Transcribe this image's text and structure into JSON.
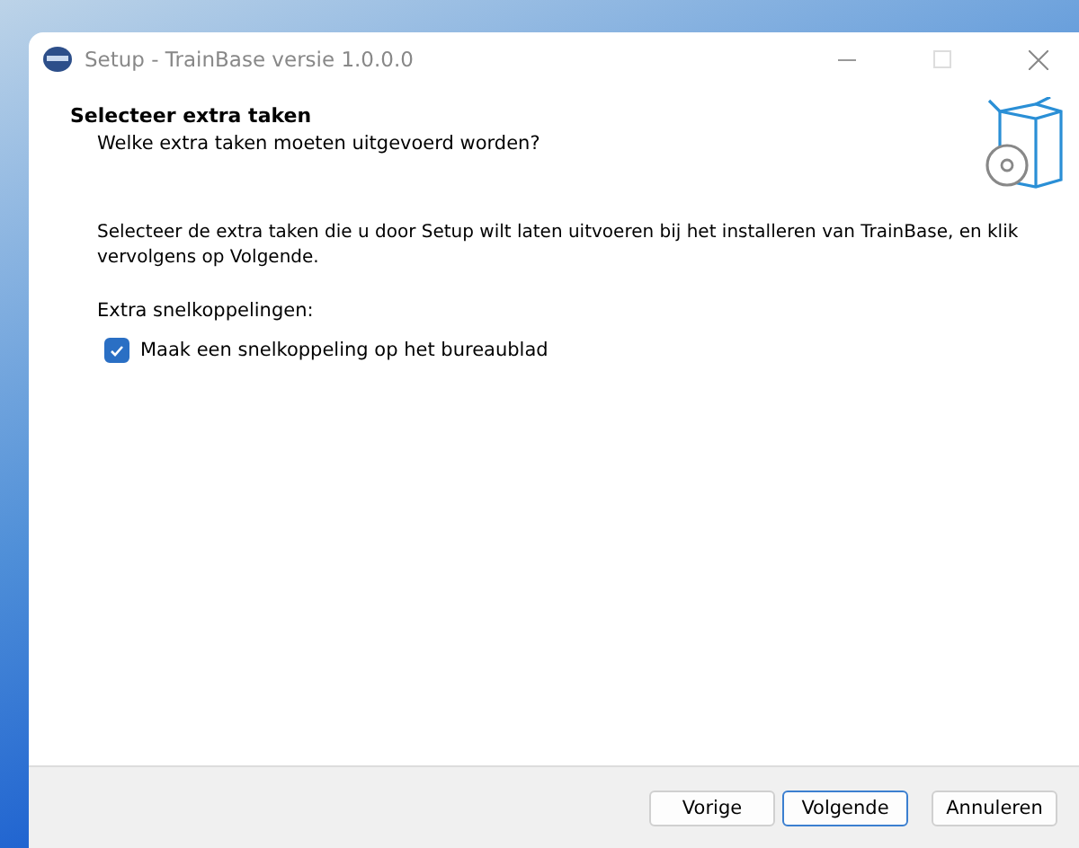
{
  "window": {
    "title": "Setup - TrainBase versie 1.0.0.0"
  },
  "header": {
    "title": "Selecteer extra taken",
    "subtitle": "Welke extra taken moeten uitgevoerd worden?"
  },
  "description": "Selecteer de extra taken die u door Setup wilt laten uitvoeren bij het installeren van TrainBase, en klik vervolgens op Volgende.",
  "group_label": "Extra snelkoppelingen:",
  "tasks": [
    {
      "label": "Maak een snelkoppeling op het bureaublad",
      "checked": true
    }
  ],
  "buttons": [
    {
      "label": "Vorige",
      "selected": false
    },
    {
      "label": "Volgende",
      "selected": true
    },
    {
      "label": "Annuleren",
      "selected": false
    }
  ]
}
